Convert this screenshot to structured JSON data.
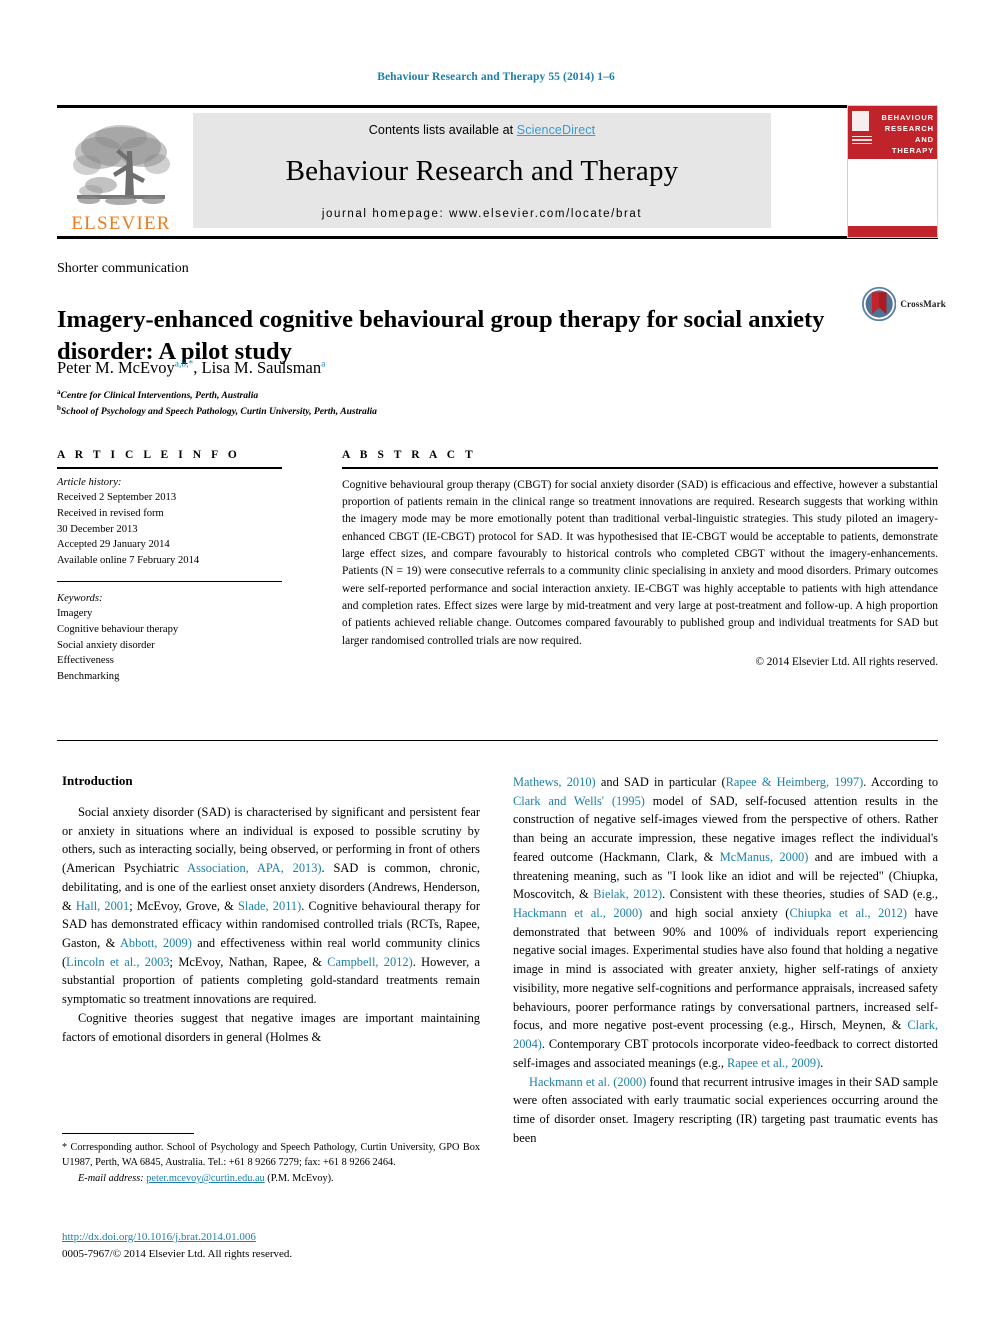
{
  "running_head": "Behaviour Research and Therapy 55 (2014) 1–6",
  "masthead": {
    "contents_prefix": "Contents lists available at ",
    "sciencedirect": "ScienceDirect",
    "journal_title": "Behaviour Research and Therapy",
    "homepage": "journal homepage: www.elsevier.com/locate/brat",
    "publisher_logo_text": "ELSEVIER",
    "publisher_logo_icon": "elsevier-tree-icon",
    "cover_title": "BEHAVIOUR RESEARCH AND THERAPY",
    "accent_teal": "#1b7fa8",
    "accent_orange": "#E87C1E",
    "cover_red": "#c0232a",
    "band_grey": "#e6e6e6"
  },
  "article": {
    "section_label": "Shorter communication",
    "title": "Imagery-enhanced cognitive behavioural group therapy for social anxiety disorder: A pilot study",
    "author_1": "Peter M. McEvoy",
    "author_1_sup": "a,b,*",
    "author_2": "Lisa M. Saulsman",
    "author_2_sup": "a",
    "affiliation_a_sup": "a",
    "affiliation_a": "Centre for Clinical Interventions, Perth, Australia",
    "affiliation_b_sup": "b",
    "affiliation_b": "School of Psychology and Speech Pathology, Curtin University, Perth, Australia",
    "crossmark_label": "CrossMark"
  },
  "info": {
    "heading": "A R T I C L E  I N F O",
    "history_label": "Article history:",
    "received": "Received 2 September 2013",
    "revised_label": "Received in revised form",
    "revised_date": "30 December 2013",
    "accepted": "Accepted 29 January 2014",
    "available": "Available online 7 February 2014",
    "keywords_label": "Keywords:",
    "keywords": [
      "Imagery",
      "Cognitive behaviour therapy",
      "Social anxiety disorder",
      "Effectiveness",
      "Benchmarking"
    ]
  },
  "abstract": {
    "heading": "A B S T R A C T",
    "text": "Cognitive behavioural group therapy (CBGT) for social anxiety disorder (SAD) is efficacious and effective, however a substantial proportion of patients remain in the clinical range so treatment innovations are required. Research suggests that working within the imagery mode may be more emotionally potent than traditional verbal-linguistic strategies. This study piloted an imagery-enhanced CBGT (IE-CBGT) protocol for SAD. It was hypothesised that IE-CBGT would be acceptable to patients, demonstrate large effect sizes, and compare favourably to historical controls who completed CBGT without the imagery-enhancements. Patients (N = 19) were consecutive referrals to a community clinic specialising in anxiety and mood disorders. Primary outcomes were self-reported performance and social interaction anxiety. IE-CBGT was highly acceptable to patients with high attendance and completion rates. Effect sizes were large by mid-treatment and very large at post-treatment and follow-up. A high proportion of patients achieved reliable change. Outcomes compared favourably to published group and individual treatments for SAD but larger randomised controlled trials are now required.",
    "copyright": "© 2014 Elsevier Ltd. All rights reserved."
  },
  "body": {
    "intro_heading": "Introduction",
    "left_paragraphs": [
      "Social anxiety disorder (SAD) is characterised by significant and persistent fear or anxiety in situations where an individual is exposed to possible scrutiny by others, such as interacting socially, being observed, or performing in front of others (American Psychiatric Association, APA, 2013). SAD is common, chronic, debilitating, and is one of the earliest onset anxiety disorders (Andrews, Henderson, & Hall, 2001; McEvoy, Grove, & Slade, 2011). Cognitive behavioural therapy for SAD has demonstrated efficacy within randomised controlled trials (RCTs, Rapee, Gaston, & Abbott, 2009) and effectiveness within real world community clinics (Lincoln et al., 2003; McEvoy, Nathan, Rapee, & Campbell, 2012). However, a substantial proportion of patients completing gold-standard treatments remain symptomatic so treatment innovations are required.",
      "Cognitive theories suggest that negative images are important maintaining factors of emotional disorders in general (Holmes &"
    ],
    "right_paragraphs": [
      "Mathews, 2010) and SAD in particular (Rapee & Heimberg, 1997). According to Clark and Wells' (1995) model of SAD, self-focused attention results in the construction of negative self-images viewed from the perspective of others. Rather than being an accurate impression, these negative images reflect the individual's feared outcome (Hackmann, Clark, & McManus, 2000) and are imbued with a threatening meaning, such as \"I look like an idiot and will be rejected\" (Chiupka, Moscovitch, & Bielak, 2012). Consistent with these theories, studies of SAD (e.g., Hackmann et al., 2000) and high social anxiety (Chiupka et al., 2012) have demonstrated that between 90% and 100% of individuals report experiencing negative social images. Experimental studies have also found that holding a negative image in mind is associated with greater anxiety, higher self-ratings of anxiety visibility, more negative self-cognitions and performance appraisals, increased safety behaviours, poorer performance ratings by conversational partners, increased self-focus, and more negative post-event processing (e.g., Hirsch, Meynen, & Clark, 2004). Contemporary CBT protocols incorporate video-feedback to correct distorted self-images and associated meanings (e.g., Rapee et al., 2009).",
      "Hackmann et al. (2000) found that recurrent intrusive images in their SAD sample were often associated with early traumatic social experiences occurring around the time of disorder onset. Imagery rescripting (IR) targeting past traumatic events has been"
    ]
  },
  "footnote": {
    "corresponding": "* Corresponding author. School of Psychology and Speech Pathology, Curtin University, GPO Box U1987, Perth, WA 6845, Australia. Tel.: +61 8 9266 7279; fax: +61 8 9266 2464.",
    "email_label": "E-mail address:",
    "email": "peter.mcevoy@curtin.edu.au",
    "email_suffix": "(P.M. McEvoy)."
  },
  "footer": {
    "doi": "http://dx.doi.org/10.1016/j.brat.2014.01.006",
    "issn_line": "0005-7967/© 2014 Elsevier Ltd. All rights reserved."
  }
}
